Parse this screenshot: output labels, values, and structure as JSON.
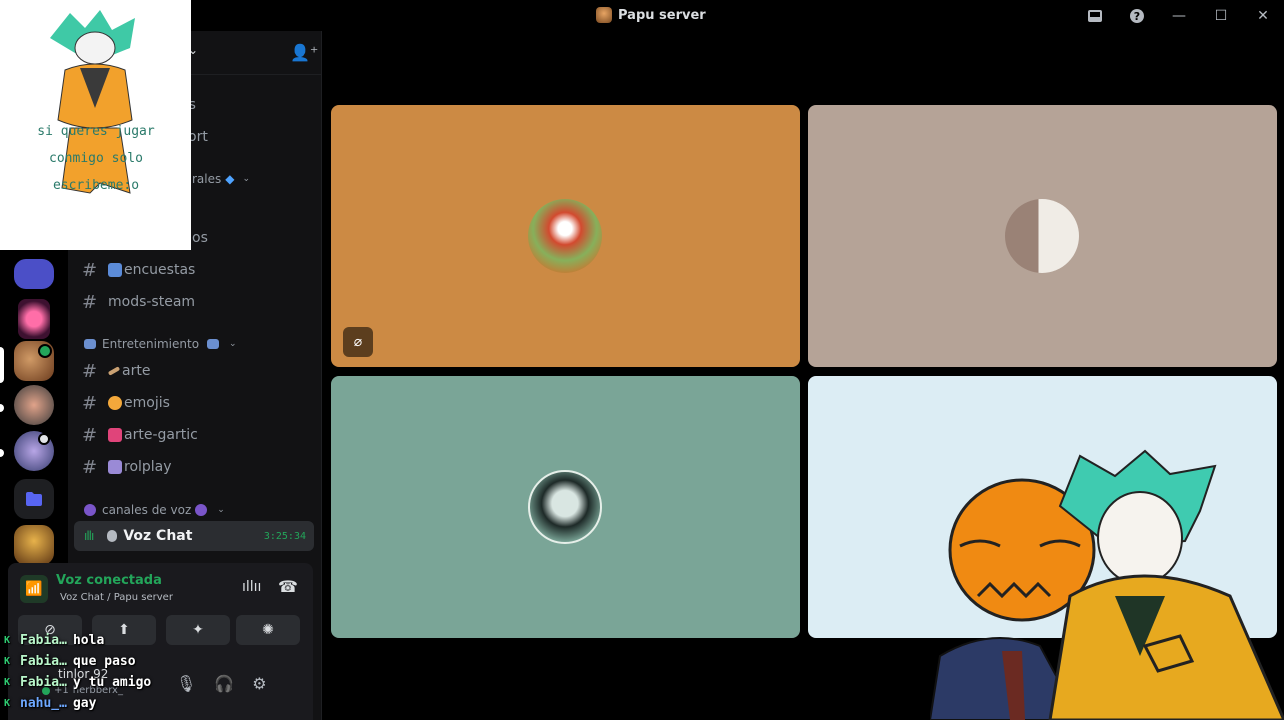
{
  "window": {
    "title": "Papu server",
    "controls": [
      "inbox-icon",
      "help-icon",
      "minimize-icon",
      "maximize-icon",
      "close-icon"
    ]
  },
  "overlay_art": {
    "text_lines": [
      "si queres jugar",
      "conmigo solo",
      "escribeme:o"
    ]
  },
  "sidebar": {
    "partial_items": [
      "as",
      "ort",
      "rales",
      "os"
    ],
    "channels": [
      {
        "name": "encuestas",
        "emoji": "chart"
      },
      {
        "name": "mods-steam",
        "emoji": ""
      }
    ],
    "category_entretenimiento": "Entretenimiento",
    "ent_channels": [
      {
        "name": "arte"
      },
      {
        "name": "emojis"
      },
      {
        "name": "arte-gartic"
      },
      {
        "name": "rolplay"
      }
    ],
    "category_voice": "canales de voz",
    "voice_channel": {
      "name": "Voz Chat",
      "timer": "3:25:34"
    }
  },
  "voice_panel": {
    "status": "Voz conectada",
    "location": "Voz Chat / Papu server"
  },
  "user_area": {
    "username": "tinlor 92",
    "friends_count": "+1",
    "friend_name": "herbberx_"
  },
  "chat": [
    {
      "nick": "Fabia…",
      "msg": "hola"
    },
    {
      "nick": "Fabia…",
      "msg": "que paso"
    },
    {
      "nick": "Fabia…",
      "msg": "y tu amigo"
    },
    {
      "nick": "nahu_…",
      "msg": "gay"
    }
  ],
  "colors": {
    "tile_orange": "#cc8a44",
    "tile_taupe": "#b5a397",
    "tile_teal": "#7aa597",
    "tile_light": "#dcedf4",
    "voice_green": "#23a55a"
  }
}
